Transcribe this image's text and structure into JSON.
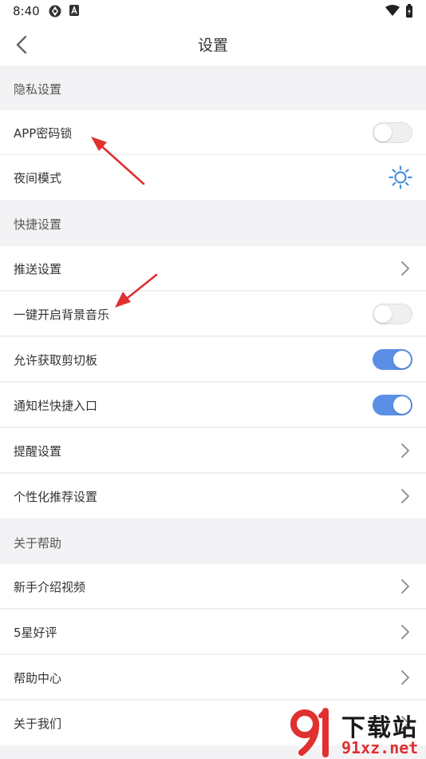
{
  "status_bar": {
    "time": "8:40"
  },
  "header": {
    "title": "设置"
  },
  "sections": {
    "privacy": {
      "title": "隐私设置",
      "items": [
        {
          "label": "APP密码锁",
          "control": "toggle",
          "on": false
        },
        {
          "label": "夜间模式",
          "control": "sun-icon"
        }
      ]
    },
    "quick": {
      "title": "快捷设置",
      "items": [
        {
          "label": "推送设置",
          "control": "chevron"
        },
        {
          "label": "一键开启背景音乐",
          "control": "toggle",
          "on": false
        },
        {
          "label": "允许获取剪切板",
          "control": "toggle",
          "on": true
        },
        {
          "label": "通知栏快捷入口",
          "control": "toggle",
          "on": true
        },
        {
          "label": "提醒设置",
          "control": "chevron"
        },
        {
          "label": "个性化推荐设置",
          "control": "chevron"
        }
      ]
    },
    "about": {
      "title": "关于帮助",
      "items": [
        {
          "label": "新手介绍视频",
          "control": "chevron"
        },
        {
          "label": "5星好评",
          "control": "chevron"
        },
        {
          "label": "帮助中心",
          "control": "chevron"
        },
        {
          "label": "关于我们",
          "control": "chevron"
        }
      ]
    }
  },
  "watermark": {
    "title": "下载站",
    "url": "91xz.net"
  },
  "colors": {
    "toggle_on": "#5b8fe6",
    "accent_sun": "#4a90e2",
    "annotation_arrow": "#e0302f"
  }
}
